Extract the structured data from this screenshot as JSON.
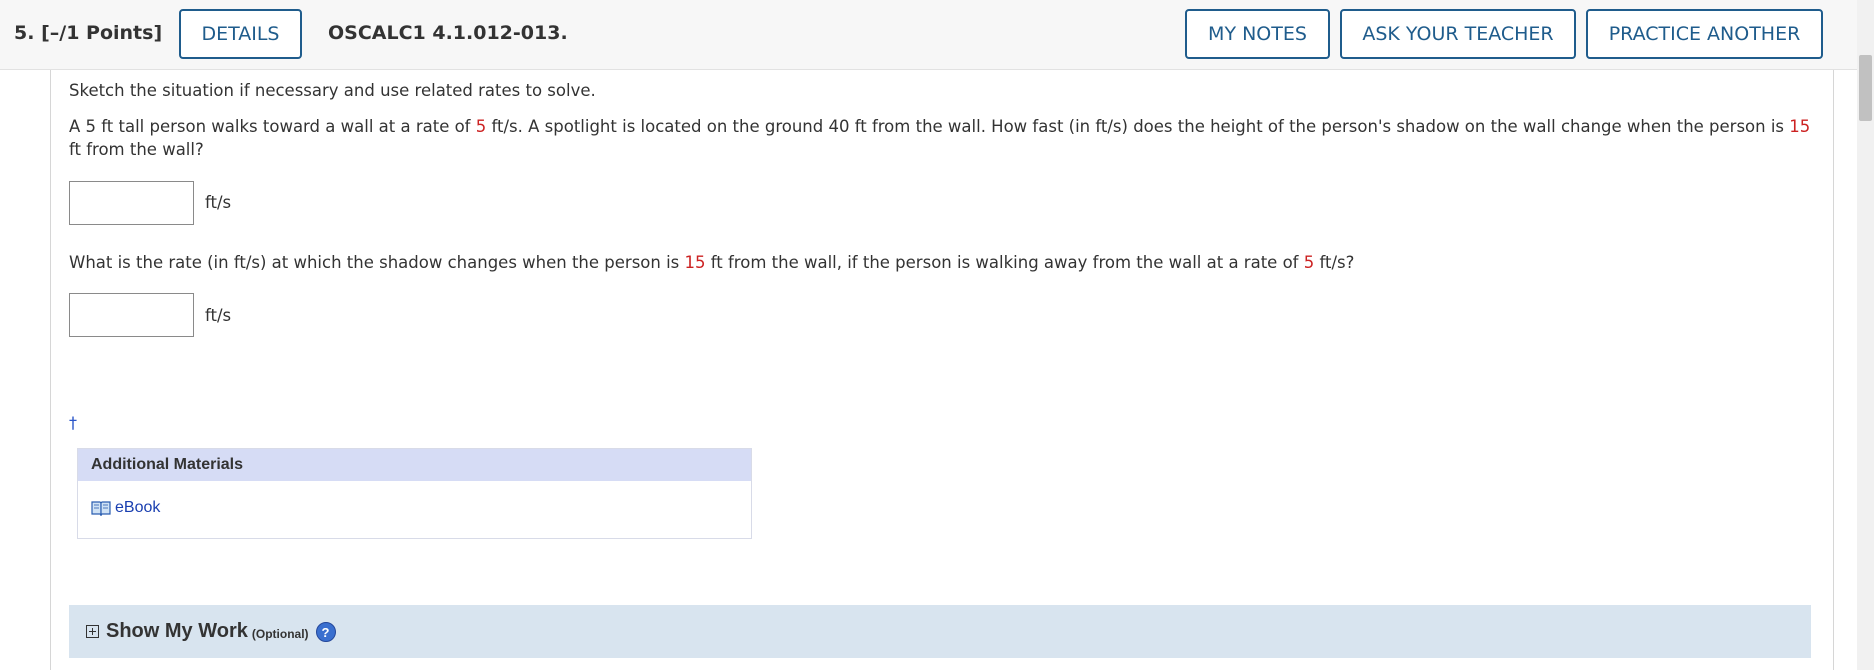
{
  "header": {
    "question_number": "5.",
    "points": "[–/1 Points]",
    "details_label": "DETAILS",
    "question_code": "OSCALC1 4.1.012-013.",
    "my_notes_label": "MY NOTES",
    "ask_teacher_label": "ASK YOUR TEACHER",
    "practice_another_label": "PRACTICE ANOTHER"
  },
  "question": {
    "instruction": "Sketch the situation if necessary and use related rates to solve.",
    "part1": {
      "t1": "A 5 ft tall person walks toward a wall at a rate of ",
      "v1": "5",
      "t2": " ft/s. A spotlight is located on the ground 40 ft from the wall. How fast (in ft/s) does the height of the person's shadow on the wall change when the person is ",
      "v2": "15",
      "t3": " ft from the wall?"
    },
    "answer1": {
      "value": "",
      "unit": "ft/s"
    },
    "part2": {
      "t1": "What is the rate (in ft/s) at which the shadow changes when the person is ",
      "v1": "15",
      "t2": " ft from the wall, if the person is walking away from the wall at a rate of ",
      "v2": "5",
      "t3": " ft/s?"
    },
    "answer2": {
      "value": "",
      "unit": "ft/s"
    },
    "footnote_mark": "†"
  },
  "materials": {
    "heading": "Additional Materials",
    "ebook_label": "eBook",
    "icon": "book-icon"
  },
  "work": {
    "title": "Show My Work",
    "optional": "(Optional)",
    "help_glyph": "?",
    "icons": [
      "expand-plus-icon",
      "help-icon"
    ]
  },
  "colors": {
    "accent": "#1f5c8c",
    "highlight_value": "#cc2222",
    "materials_header": "#d6dcf5",
    "work_bar": "#d8e4ef"
  }
}
